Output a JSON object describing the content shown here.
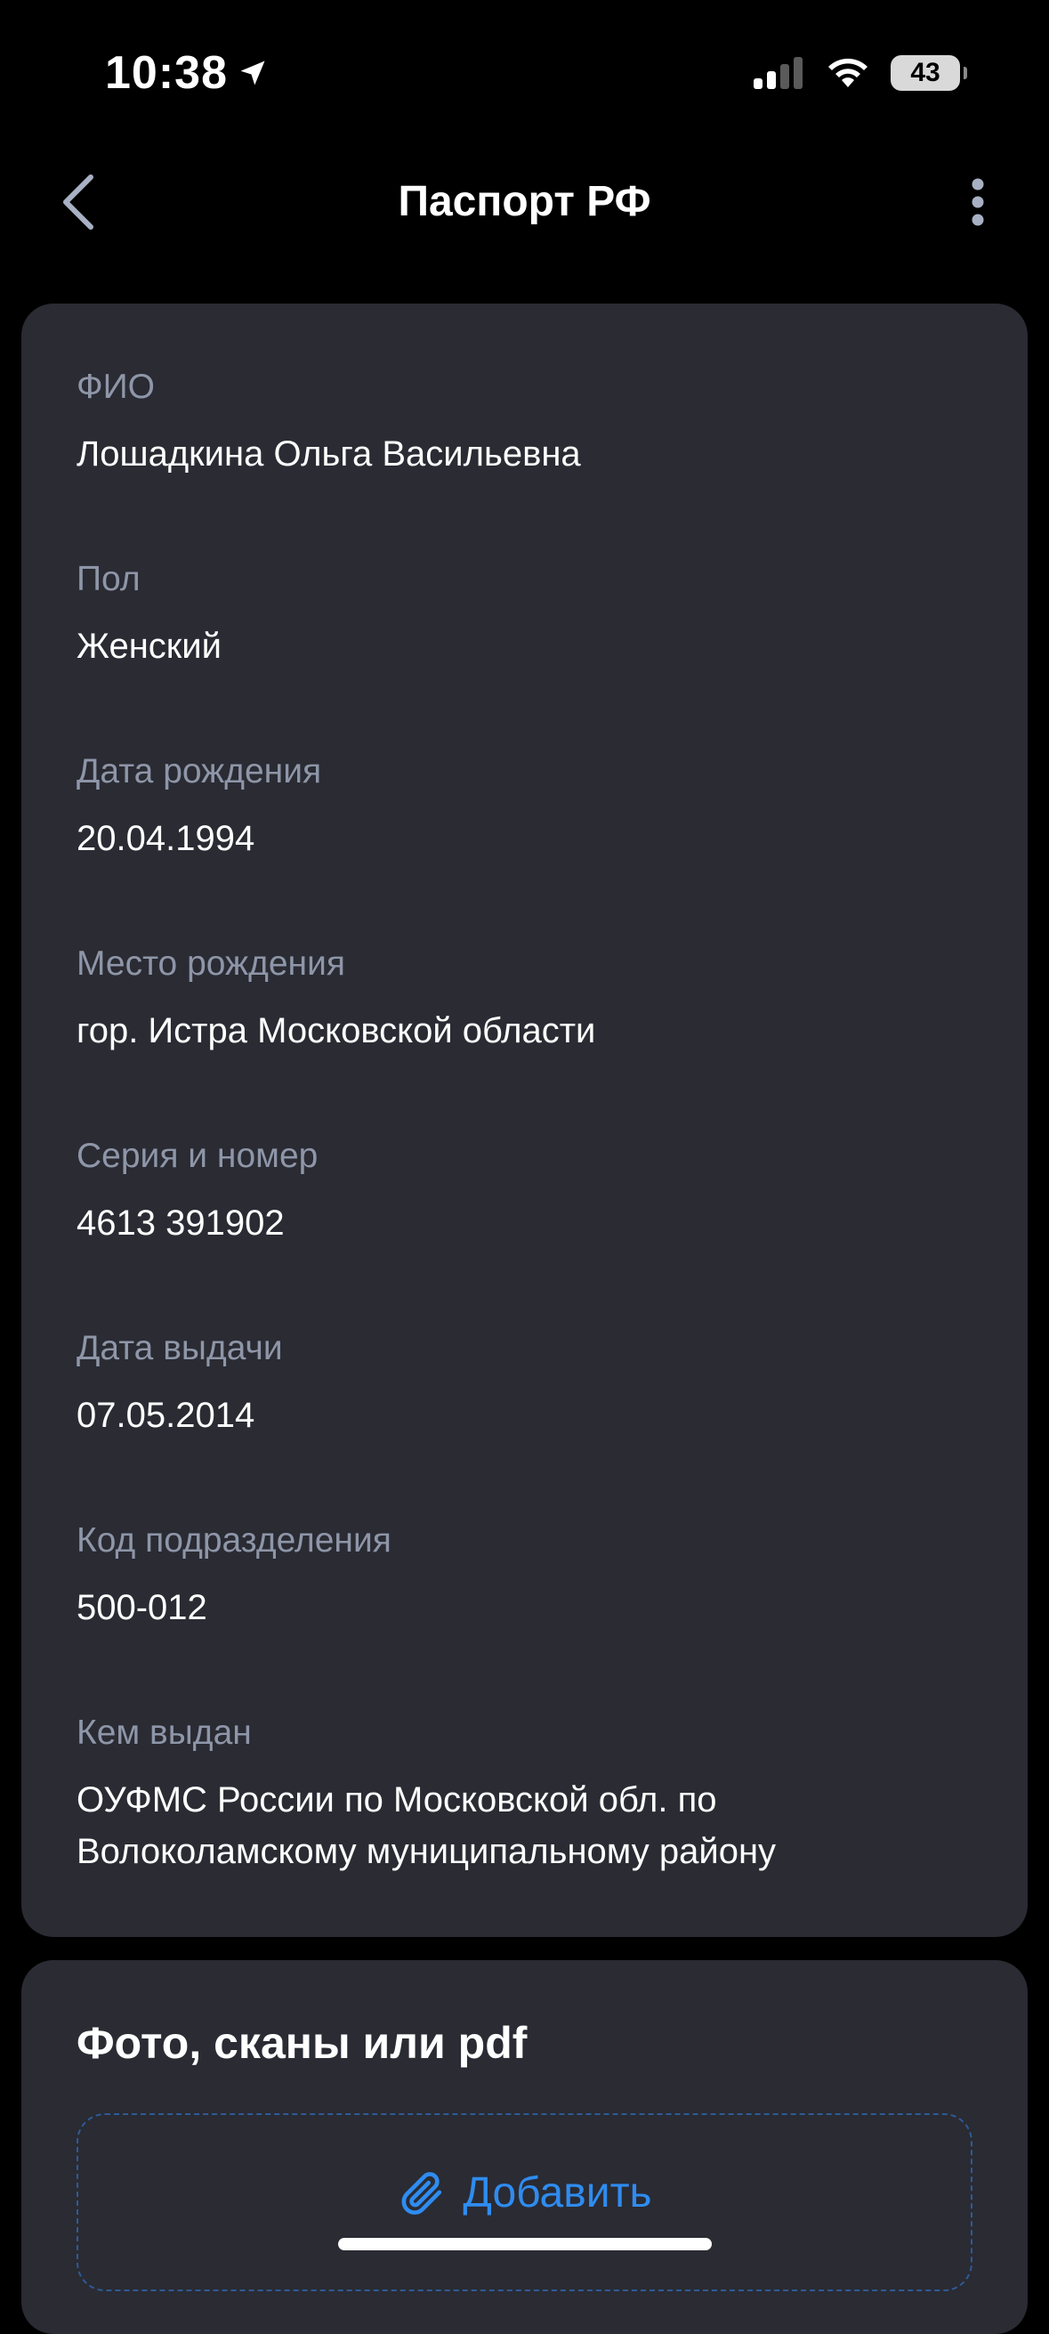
{
  "status_bar": {
    "time": "10:38",
    "battery": "43",
    "location_icon": "location-arrow-icon",
    "signal_icon": "cellular-signal-icon",
    "wifi_icon": "wifi-icon"
  },
  "nav": {
    "title": "Паспорт РФ",
    "back_icon": "chevron-left-icon",
    "more_icon": "more-vertical-icon"
  },
  "fields": [
    {
      "label": "ФИО",
      "value": "Лошадкина Ольга Васильевна"
    },
    {
      "label": "Пол",
      "value": "Женский"
    },
    {
      "label": "Дата рождения",
      "value": "20.04.1994"
    },
    {
      "label": "Место рождения",
      "value": "гор. Истра Московской области"
    },
    {
      "label": "Серия и номер",
      "value": "4613 391902"
    },
    {
      "label": "Дата выдачи",
      "value": "07.05.2014"
    },
    {
      "label": "Код подразделения",
      "value": "500-012"
    },
    {
      "label": "Кем выдан",
      "value": "ОУФМС России по Московской обл. по Волоколамскому муниципальному району"
    }
  ],
  "files": {
    "title": "Фото, сканы или pdf",
    "add_label": "Добавить",
    "add_icon": "paperclip-icon"
  },
  "colors": {
    "background": "#000000",
    "card": "#2a2b33",
    "label": "#8e96a8",
    "accent": "#2f8cf0"
  }
}
